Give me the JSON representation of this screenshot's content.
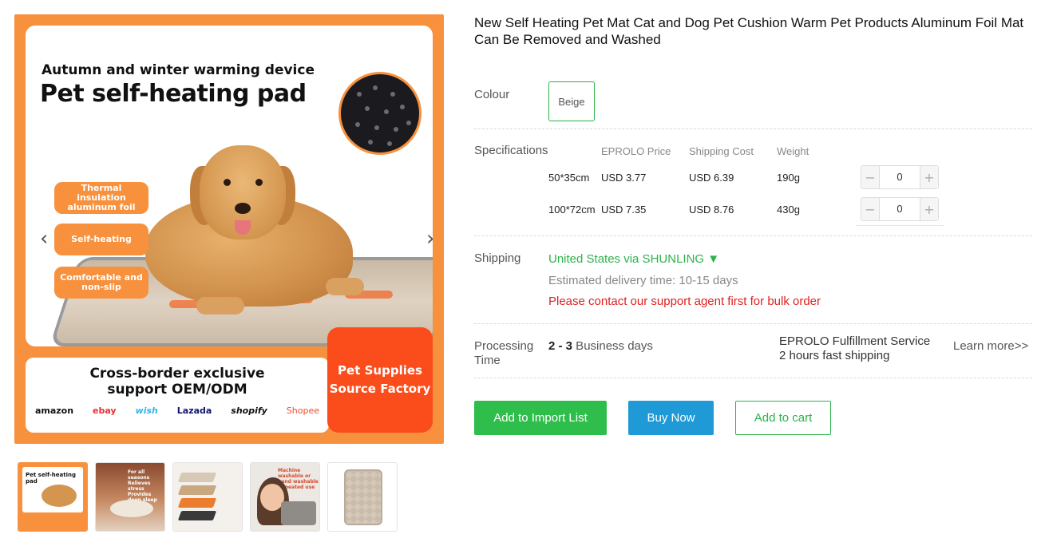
{
  "gallery": {
    "main": {
      "subtitle": "Autumn and winter warming device",
      "title": "Pet self-heating pad",
      "features": [
        "Thermal insulation aluminum foil",
        "Self-heating",
        "Comfortable and non-slip"
      ],
      "bottom_line1": "Cross-border exclusive",
      "bottom_line2": "support OEM/ODM",
      "platforms": [
        "amazon",
        "ebay",
        "wish",
        "Lazada",
        "shopify",
        "Shopee"
      ],
      "factory_line1": "Pet Supplies",
      "factory_line2": "Source Factory",
      "prev_icon": "chevron-left-icon",
      "next_icon": "chevron-right-icon"
    },
    "thumbnails": [
      {
        "title": "Pet self-heating pad"
      },
      {
        "text": "For all seasons Relieves stress Provides deep sleep"
      },
      {
        "text": ""
      },
      {
        "text": "Machine washable or hand washable Repeated use"
      },
      {
        "text": ""
      }
    ]
  },
  "product": {
    "title": "New Self Heating Pet Mat Cat and Dog Pet Cushion Warm Pet Products Aluminum Foil Mat Can Be Removed and Washed",
    "colour_label": "Colour",
    "colour_option": "Beige",
    "specs_label": "Specifications",
    "spec_headers": [
      "EPROLO Price",
      "Shipping Cost",
      "Weight"
    ],
    "specs": [
      {
        "size": "50*35cm",
        "price": "USD 3.77",
        "shipping": "USD 6.39",
        "weight": "190g",
        "qty": "0"
      },
      {
        "size": "100*72cm",
        "price": "USD 7.35",
        "shipping": "USD 8.76",
        "weight": "430g",
        "qty": "0"
      }
    ],
    "shipping_label": "Shipping",
    "shipping_method": "United States via SHUNLING ▼",
    "delivery_time": "Estimated delivery time: 10-15 days",
    "bulk_notice": "Please contact our support agent first for bulk order",
    "processing_label_1": "Processing",
    "processing_label_2": "Time",
    "processing_days_bold": "2 - 3",
    "processing_days_rest": " Business days",
    "fulfillment_line1": "EPROLO Fulfillment Service",
    "fulfillment_line2": "2 hours fast shipping",
    "learn_more": "Learn more>>"
  },
  "actions": {
    "import": "Add to Import List",
    "buy": "Buy Now",
    "cart": "Add to cart"
  },
  "colors": {
    "accent_green": "#2fbd4b",
    "buy_blue": "#1f9ad6",
    "warning_red": "#e02020",
    "brand_orange": "#f7913d"
  }
}
